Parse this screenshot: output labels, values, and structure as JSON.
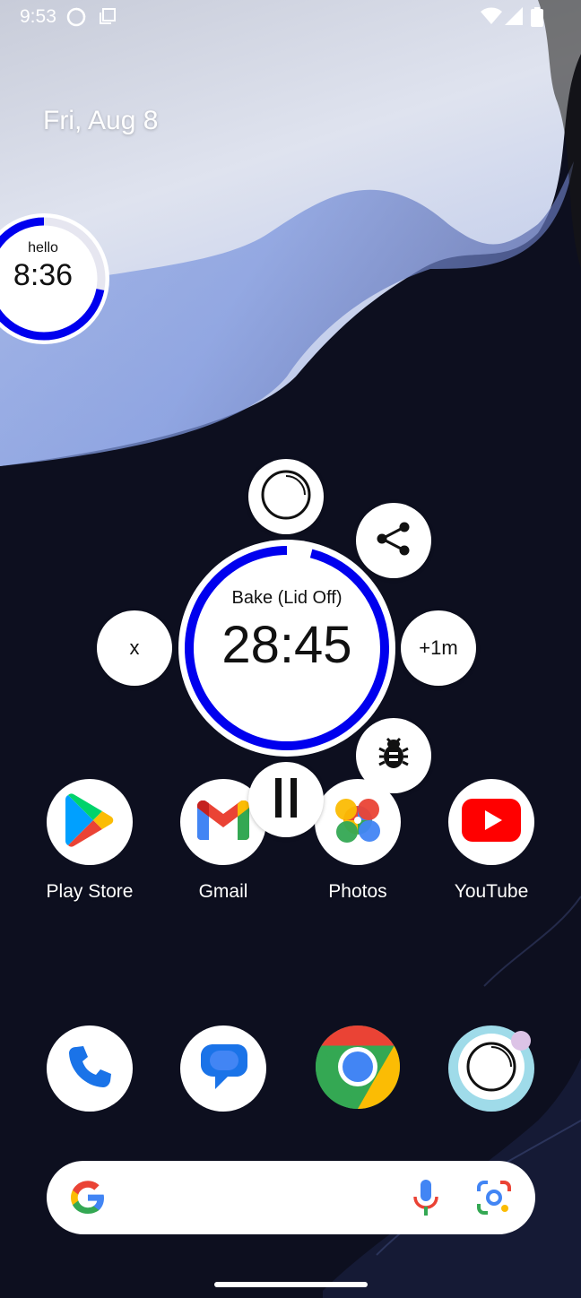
{
  "status_bar": {
    "time": "9:53",
    "icons": [
      "loading-circle-icon",
      "screenshot-icon",
      "wifi-icon",
      "signal-icon",
      "battery-icon"
    ]
  },
  "home": {
    "date": "Fri, Aug 8"
  },
  "mini_timer": {
    "label": "hello",
    "time": "8:36",
    "progress": 0.72,
    "ring_color": "#0000ee"
  },
  "timer": {
    "label": "Bake (Lid Off)",
    "time": "28:45",
    "progress": 0.96,
    "ring_color": "#0000ee",
    "buttons": {
      "reset_icon": "loading-circle-icon",
      "share_icon": "share-icon",
      "dismiss_label": "x",
      "add_minute_label": "+1m",
      "debug_icon": "bug-icon",
      "pause_icon": "pause-icon"
    }
  },
  "apps_row1": [
    {
      "label": "Play Store",
      "icon": "play-store-icon"
    },
    {
      "label": "Gmail",
      "icon": "gmail-icon"
    },
    {
      "label": "Photos",
      "icon": "photos-icon"
    },
    {
      "label": "YouTube",
      "icon": "youtube-icon"
    }
  ],
  "dock": [
    {
      "icon": "phone-icon"
    },
    {
      "icon": "messages-icon"
    },
    {
      "icon": "chrome-icon"
    },
    {
      "icon": "timer-app-icon"
    }
  ],
  "search": {
    "icons": [
      "google-g-icon",
      "microphone-icon",
      "lens-icon"
    ]
  },
  "colors": {
    "accent": "#0000ee",
    "google_blue": "#4285f4",
    "google_red": "#ea4335",
    "google_yellow": "#fbbc04",
    "google_green": "#34a853"
  }
}
